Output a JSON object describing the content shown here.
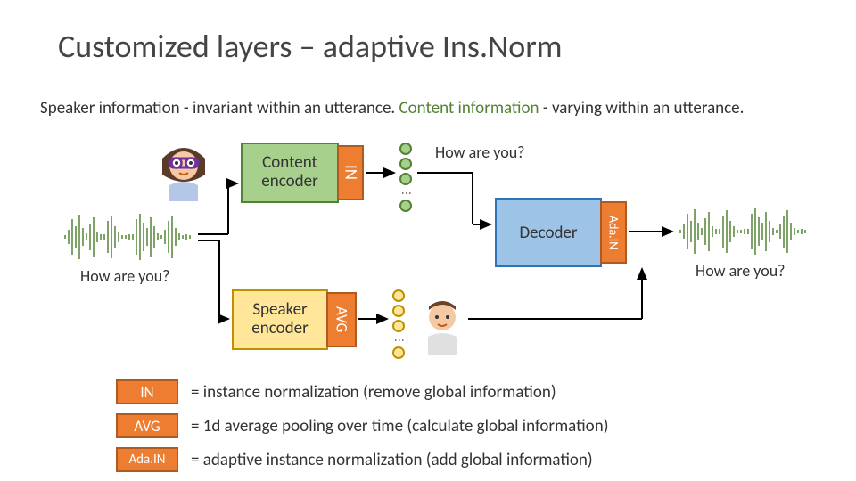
{
  "title": "Customized layers – adaptive Ins.Norm",
  "subtitle_a": "Speaker information - invariant within an utterance. ",
  "subtitle_b": "Content information",
  "subtitle_c": " - varying within an utterance.",
  "blocks": {
    "content_encoder_l1": "Content",
    "content_encoder_l2": "encoder",
    "in": "IN",
    "decoder": "Decoder",
    "adain": "Ada.IN",
    "speaker_encoder_l1": "Speaker",
    "speaker_encoder_l2": "encoder",
    "avg": "AVG"
  },
  "labels": {
    "how_top": "How are you?",
    "how_left": "How are you?",
    "how_right": "How are you?"
  },
  "legend": {
    "in_chip": "IN",
    "in_text": "= instance normalization  (remove global information)",
    "avg_chip": "AVG",
    "avg_text": "= 1d average pooling over time  (calculate global information)",
    "adain_chip": "Ada.IN",
    "adain_text": "= adaptive instance normalization (add global information)"
  }
}
